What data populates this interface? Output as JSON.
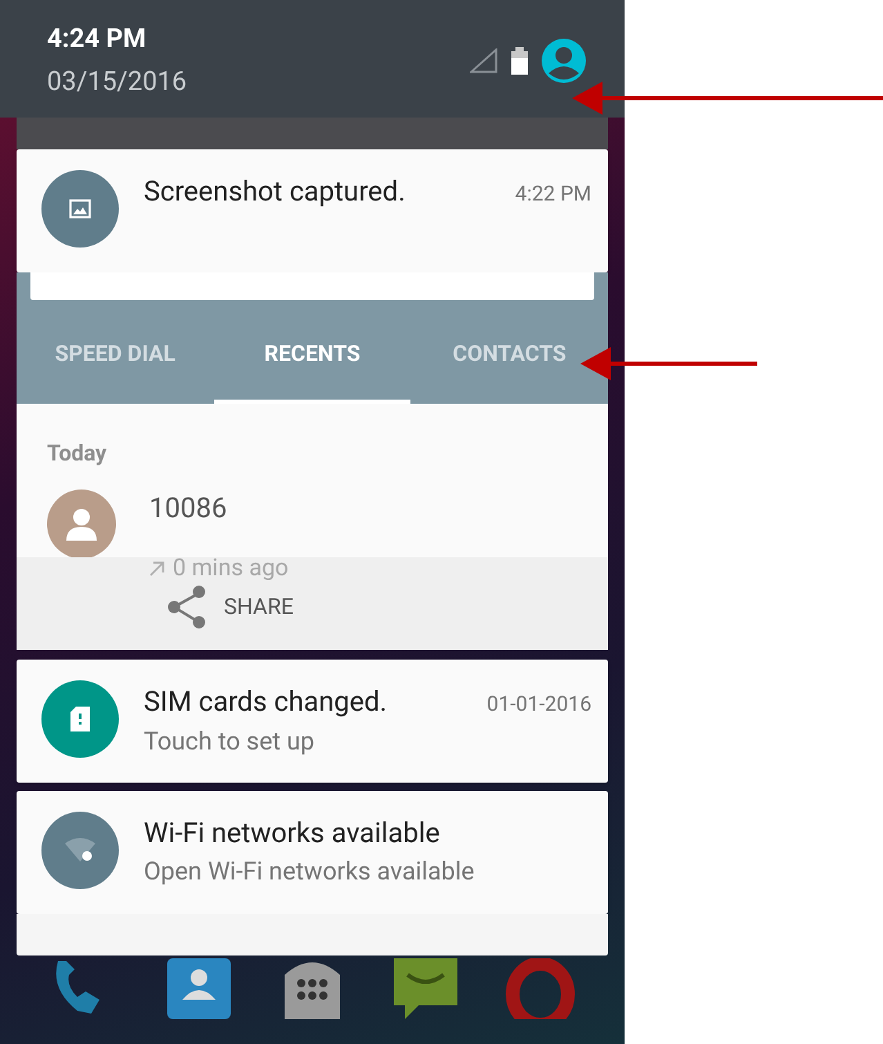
{
  "status_header": {
    "time": "4:24 PM",
    "date": "03/15/2016"
  },
  "notifications_top": [
    {
      "kind": "screenshot",
      "title": "Screenshot captured.",
      "time": "4:22 PM"
    }
  ],
  "dialer": {
    "tabs": [
      {
        "label": "SPEED DIAL",
        "selected": false
      },
      {
        "label": "RECENTS",
        "selected": true
      },
      {
        "label": "CONTACTS",
        "selected": false
      }
    ],
    "section": "Today",
    "call": {
      "number": "10086",
      "time_ago": "0 mins ago"
    },
    "share_action": "SHARE"
  },
  "notifications": [
    {
      "kind": "sim",
      "title": "SIM cards changed.",
      "text": "Touch to set up",
      "time": "01-01-2016"
    },
    {
      "kind": "wifi",
      "title": "Wi-Fi networks available",
      "text": "Open Wi-Fi networks available"
    }
  ]
}
